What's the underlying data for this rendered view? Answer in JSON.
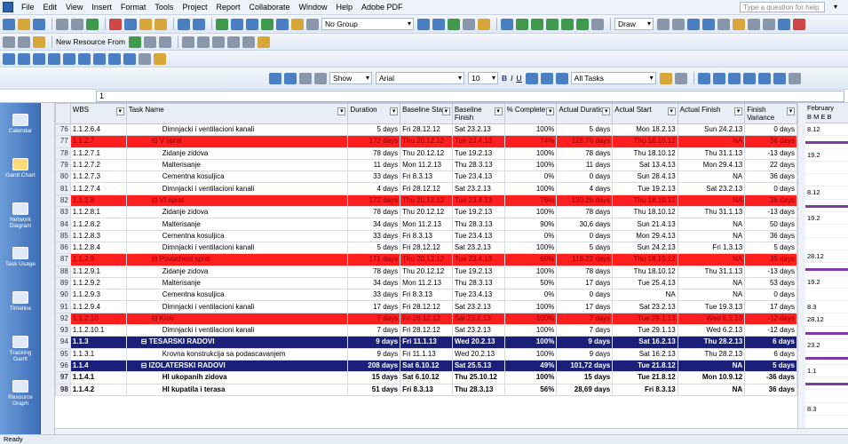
{
  "menu": [
    "File",
    "Edit",
    "View",
    "Insert",
    "Format",
    "Tools",
    "Project",
    "Report",
    "Collaborate",
    "Window",
    "Help",
    "Adobe PDF"
  ],
  "help_placeholder": "Type a question for help",
  "toolbar": {
    "group_combo": "No Group",
    "new_resource_from": "New Resource From",
    "draw": "Draw",
    "show": "Show",
    "font": "Arial",
    "font_size": "10",
    "bold": "B",
    "italic": "I",
    "underline": "U",
    "filter": "All Tasks"
  },
  "entry_bar": "1",
  "view_bar": [
    "Calendar",
    "Gantt Chart",
    "Network Diagram",
    "Task Usage",
    "Tracking Gantt",
    "Resource Graph",
    "Timeline"
  ],
  "columns": [
    "WBS",
    "Task Name",
    "Duration",
    "Baseline Start",
    "Baseline Finish",
    "% Complete",
    "Actual Duration",
    "Actual Start",
    "Actual Finish",
    "Finish Variance"
  ],
  "rows": [
    {
      "id": "76",
      "wbs": "1.1.2.6.4",
      "name": "Dimnjacki i ventilacioni kanali",
      "dur": "5 days",
      "bs": "Fri 28.12.12",
      "bf": "Sat 23.2.13",
      "pc": "100%",
      "ad": "5 days",
      "as": "Mon 18.2.13",
      "af": "Sun 24.2.13",
      "fv": "0 days",
      "style": "normal",
      "indent": 3
    },
    {
      "id": "77",
      "wbs": "1.1.2.7",
      "name": "V sprat",
      "dur": "172 days",
      "bs": "Thu 20.12.12",
      "bf": "Tue 23.4.13",
      "pc": "74%",
      "ad": "126.76 days",
      "as": "Thu 18.10.12",
      "af": "NA",
      "fv": "36 days",
      "style": "red",
      "indent": 2
    },
    {
      "id": "78",
      "wbs": "1.1.2.7.1",
      "name": "Zidanje zidova",
      "dur": "78 days",
      "bs": "Thu 20.12.12",
      "bf": "Tue 19.2.13",
      "pc": "100%",
      "ad": "78 days",
      "as": "Thu 18.10.12",
      "af": "Thu 31.1.13",
      "fv": "-13 days",
      "style": "normal",
      "indent": 3
    },
    {
      "id": "79",
      "wbs": "1.1.2.7.2",
      "name": "Malterisanje",
      "dur": "11 days",
      "bs": "Mon 11.2.13",
      "bf": "Thu 28.3.13",
      "pc": "100%",
      "ad": "11 days",
      "as": "Sat 13.4.13",
      "af": "Mon 29.4.13",
      "fv": "22 days",
      "style": "normal",
      "indent": 3
    },
    {
      "id": "80",
      "wbs": "1.1.2.7.3",
      "name": "Cementna kosuljica",
      "dur": "33 days",
      "bs": "Fri 8.3.13",
      "bf": "Tue 23.4.13",
      "pc": "0%",
      "ad": "0 days",
      "as": "Sun 28.4.13",
      "af": "NA",
      "fv": "36 days",
      "style": "normal",
      "indent": 3
    },
    {
      "id": "81",
      "wbs": "1.1.2.7.4",
      "name": "Dimnjacki i ventilacioni kanali",
      "dur": "4 days",
      "bs": "Fri 28.12.12",
      "bf": "Sat 23.2.13",
      "pc": "100%",
      "ad": "4 days",
      "as": "Tue 19.2.13",
      "af": "Sat 23.2.13",
      "fv": "0 days",
      "style": "normal",
      "indent": 3
    },
    {
      "id": "82",
      "wbs": "1.1.2.8",
      "name": "VI sprat",
      "dur": "172 days",
      "bs": "Thu 20.12.12",
      "bf": "Tue 23.4.13",
      "pc": "76%",
      "ad": "130.26 days",
      "as": "Thu 18.10.12",
      "af": "NA",
      "fv": "36 days",
      "style": "red",
      "indent": 2
    },
    {
      "id": "83",
      "wbs": "1.1.2.8.1",
      "name": "Zidanje zidova",
      "dur": "78 days",
      "bs": "Thu 20.12.12",
      "bf": "Tue 19.2.13",
      "pc": "100%",
      "ad": "78 days",
      "as": "Thu 18.10.12",
      "af": "Thu 31.1.13",
      "fv": "-13 days",
      "style": "normal",
      "indent": 3
    },
    {
      "id": "84",
      "wbs": "1.1.2.8.2",
      "name": "Malterisanje",
      "dur": "34 days",
      "bs": "Mon 11.2.13",
      "bf": "Thu 28.3.13",
      "pc": "90%",
      "ad": "30,6 days",
      "as": "Sun 21.4.13",
      "af": "NA",
      "fv": "50 days",
      "style": "normal",
      "indent": 3
    },
    {
      "id": "85",
      "wbs": "1.1.2.8.3",
      "name": "Cementna kosuljica",
      "dur": "33 days",
      "bs": "Fri 8.3.13",
      "bf": "Tue 23.4.13",
      "pc": "0%",
      "ad": "0 days",
      "as": "Mon 29.4.13",
      "af": "NA",
      "fv": "36 days",
      "style": "normal",
      "indent": 3
    },
    {
      "id": "86",
      "wbs": "1.1.2.8.4",
      "name": "Dimnjacki i ventilacioni kanali",
      "dur": "5 days",
      "bs": "Fri 28.12.12",
      "bf": "Sat 23.2.13",
      "pc": "100%",
      "ad": "5 days",
      "as": "Sun 24.2.13",
      "af": "Fri 1.3.13",
      "fv": "5 days",
      "style": "normal",
      "indent": 3
    },
    {
      "id": "87",
      "wbs": "1.1.2.9",
      "name": "Povucheni sprat",
      "dur": "171 days",
      "bs": "Thu 20.12.12",
      "bf": "Tue 23.4.13",
      "pc": "69%",
      "ad": "118.22 days",
      "as": "Thu 18.10.12",
      "af": "NA",
      "fv": "35 days",
      "style": "red",
      "indent": 2
    },
    {
      "id": "88",
      "wbs": "1.1.2.9.1",
      "name": "Zidanje zidova",
      "dur": "78 days",
      "bs": "Thu 20.12.12",
      "bf": "Tue 19.2.13",
      "pc": "100%",
      "ad": "78 days",
      "as": "Thu 18.10.12",
      "af": "Thu 31.1.13",
      "fv": "-13 days",
      "style": "normal",
      "indent": 3
    },
    {
      "id": "89",
      "wbs": "1.1.2.9.2",
      "name": "Malterisanje",
      "dur": "34 days",
      "bs": "Mon 11.2.13",
      "bf": "Thu 28.3.13",
      "pc": "50%",
      "ad": "17 days",
      "as": "Tue 25.4.13",
      "af": "NA",
      "fv": "53 days",
      "style": "normal",
      "indent": 3
    },
    {
      "id": "90",
      "wbs": "1.1.2.9.3",
      "name": "Cementna kosuljica",
      "dur": "33 days",
      "bs": "Fri 8.3.13",
      "bf": "Tue 23.4.13",
      "pc": "0%",
      "ad": "0 days",
      "as": "NA",
      "af": "NA",
      "fv": "0 days",
      "style": "normal",
      "indent": 3
    },
    {
      "id": "91",
      "wbs": "1.1.2.9.4",
      "name": "Dimnjacki i ventilacioni kanali",
      "dur": "17 days",
      "bs": "Fri 28.12.12",
      "bf": "Sat 23.2.13",
      "pc": "100%",
      "ad": "17 days",
      "as": "Sat 23.2.13",
      "af": "Tue 19.3.13",
      "fv": "17 days",
      "style": "normal",
      "indent": 3
    },
    {
      "id": "92",
      "wbs": "1.1.2.10",
      "name": "Krov",
      "dur": "7 days",
      "bs": "Fri 28.12.12",
      "bf": "Sat 23.2.13",
      "pc": "100%",
      "ad": "7 days",
      "as": "Tue 29.1.13",
      "af": "Wed 6.2.13",
      "fv": "-12 days",
      "style": "red",
      "indent": 2
    },
    {
      "id": "93",
      "wbs": "1.1.2.10.1",
      "name": "Dimnjacki i ventilacioni kanali",
      "dur": "7 days",
      "bs": "Fri 28.12.12",
      "bf": "Sat 23.2.13",
      "pc": "100%",
      "ad": "7 days",
      "as": "Tue 29.1.13",
      "af": "Wed 6.2.13",
      "fv": "-12 days",
      "style": "normal",
      "indent": 3
    },
    {
      "id": "94",
      "wbs": "1.1.3",
      "name": "TESARSKI RADOVI",
      "dur": "9 days",
      "bs": "Fri 11.1.13",
      "bf": "Wed 20.2.13",
      "pc": "100%",
      "ad": "9 days",
      "as": "Sat 16.2.13",
      "af": "Thu 28.2.13",
      "fv": "6 days",
      "style": "navy",
      "indent": 1
    },
    {
      "id": "95",
      "wbs": "1.1.3.1",
      "name": "Krovna konstrukcija sa podascavanjem",
      "dur": "9 days",
      "bs": "Fri 11.1.13",
      "bf": "Wed 20.2.13",
      "pc": "100%",
      "ad": "9 days",
      "as": "Sat 16.2.13",
      "af": "Thu 28.2.13",
      "fv": "6 days",
      "style": "normal",
      "indent": 3
    },
    {
      "id": "96",
      "wbs": "1.1.4",
      "name": "IZOLATERSKI RADOVI",
      "dur": "208 days",
      "bs": "Sat 6.10.12",
      "bf": "Sat 25.5.13",
      "pc": "49%",
      "ad": "101,72 days",
      "as": "Tue 21.8.12",
      "af": "NA",
      "fv": "5 days",
      "style": "navy",
      "indent": 1
    },
    {
      "id": "97",
      "wbs": "1.1.4.1",
      "name": "HI ukopanih zidova",
      "dur": "15 days",
      "bs": "Sat 6.10.12",
      "bf": "Thu 25.10.12",
      "pc": "100%",
      "ad": "15 days",
      "as": "Tue 21.8.12",
      "af": "Mon 10.9.12",
      "fv": "-36 days",
      "style": "bold",
      "indent": 3
    },
    {
      "id": "98",
      "wbs": "1.1.4.2",
      "name": "HI kupatila i terasa",
      "dur": "51 days",
      "bs": "Fri 8.3.13",
      "bf": "Thu 28.3.13",
      "pc": "56%",
      "ad": "28,69 days",
      "as": "Fri 8.3.13",
      "af": "NA",
      "fv": "36 days",
      "style": "bold",
      "indent": 3
    }
  ],
  "gantt": {
    "month": "February",
    "weeks": "B M E B",
    "labels": [
      "8.12",
      "",
      "19.2",
      "",
      "",
      "8.12",
      "",
      "19.2",
      "",
      "",
      "28.12",
      "",
      "19.2",
      "",
      "8.3",
      "28.12",
      "23.2",
      "23.2",
      "1.1",
      "1.1",
      "",
      "",
      "8.3"
    ]
  },
  "status": "Ready"
}
